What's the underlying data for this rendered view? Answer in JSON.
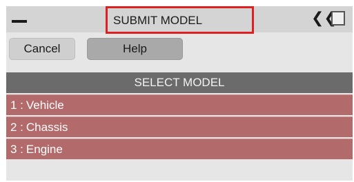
{
  "window": {
    "title": "SUBMIT MODEL",
    "minimize_icon": "minus-icon",
    "collapse_icon": "double-chevron-left-icon",
    "collapse_glyph": "❮❮",
    "maximize_icon": "square-icon",
    "highlight_color": "#e02020"
  },
  "toolbar": {
    "cancel_label": "Cancel",
    "help_label": "Help"
  },
  "model_list": {
    "header": "SELECT MODEL",
    "row_color": "#b36a6a",
    "items": [
      {
        "index": "1 :",
        "name": "Vehicle"
      },
      {
        "index": "2 :",
        "name": "Chassis"
      },
      {
        "index": "3 :",
        "name": "Engine"
      }
    ]
  }
}
